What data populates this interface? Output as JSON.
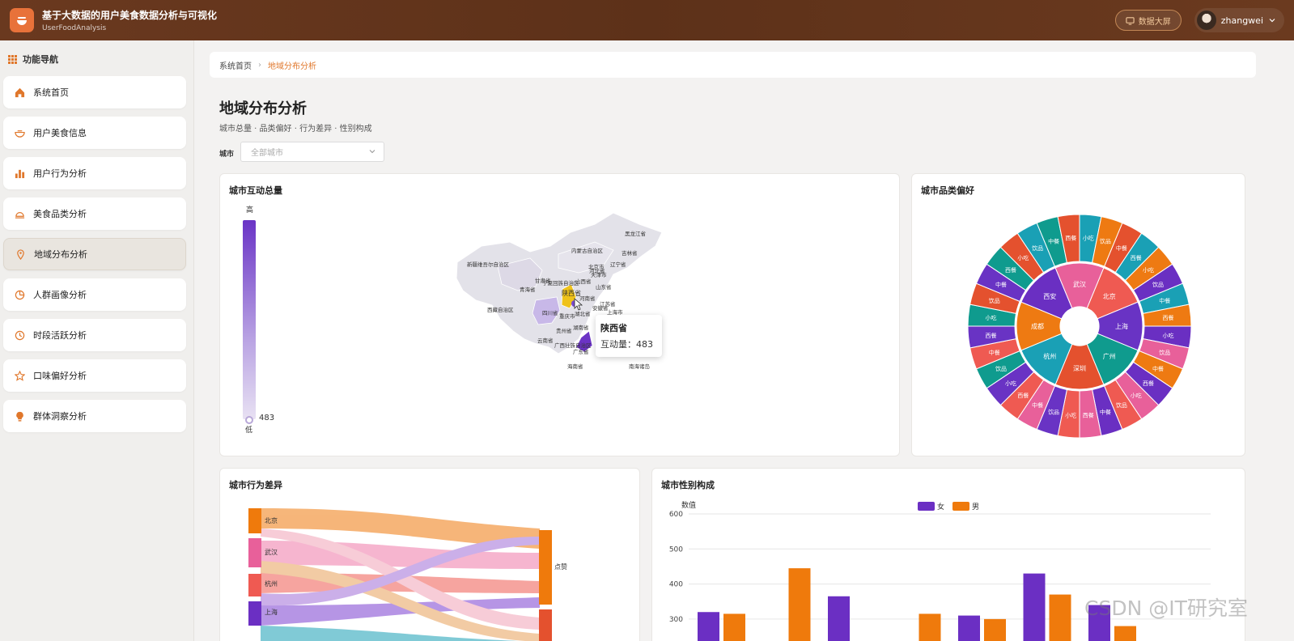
{
  "header": {
    "title": "基于大数据的用户美食数据分析与可视化",
    "subtitle": "UserFoodAnalysis",
    "screen_button": "数据大屏",
    "username": "zhangwei"
  },
  "sidebar": {
    "title": "功能导航",
    "items": [
      {
        "label": "系统首页",
        "icon": "home-icon"
      },
      {
        "label": "用户美食信息",
        "icon": "bowl-icon"
      },
      {
        "label": "用户行为分析",
        "icon": "bar-chart-icon"
      },
      {
        "label": "美食品类分析",
        "icon": "dish-icon"
      },
      {
        "label": "地域分布分析",
        "icon": "location-pin-icon",
        "active": true
      },
      {
        "label": "人群画像分析",
        "icon": "pie-icon"
      },
      {
        "label": "时段活跃分析",
        "icon": "clock-icon"
      },
      {
        "label": "口味偏好分析",
        "icon": "star-icon"
      },
      {
        "label": "群体洞察分析",
        "icon": "bulb-icon"
      }
    ]
  },
  "breadcrumb": {
    "home": "系统首页",
    "current": "地域分布分析"
  },
  "page": {
    "title": "地域分布分析",
    "subtitle": "城市总量 · 品类偏好 · 行为差异 · 性别构成",
    "filter_label": "城市",
    "filter_placeholder": "全部城市"
  },
  "map_card": {
    "title": "城市互动总量",
    "legend_high": "高",
    "legend_low": "低",
    "legend_value": "483",
    "tooltip_name": "陕西省",
    "tooltip_label": "互动量",
    "tooltip_value": "483",
    "province_labels": [
      "黑龙江省",
      "吉林省",
      "辽宁省",
      "内蒙古自治区",
      "新疆维吾尔自治区",
      "甘肃省",
      "青海省",
      "宁夏回族自治区",
      "陕西省",
      "山西省",
      "河北省",
      "北京市",
      "天津市",
      "山东省",
      "河南省",
      "江苏省",
      "安徽省",
      "上海市",
      "西藏自治区",
      "四川省",
      "重庆市",
      "湖北省",
      "湖南省",
      "贵州省",
      "云南省",
      "广西壮族自治区",
      "广东省",
      "海南省",
      "南海诸岛"
    ]
  },
  "sunburst_card": {
    "title": "城市品类偏好",
    "inner": [
      "北京",
      "上海",
      "广州",
      "深圳",
      "杭州",
      "成都",
      "西安",
      "武汉"
    ],
    "outer_categories": [
      "中餐",
      "西餐",
      "小吃",
      "饮品"
    ],
    "colors": [
      "#ef5a52",
      "#6933c4",
      "#0f9b8e",
      "#e4512e",
      "#1aa0b5",
      "#ee7a12",
      "#6a2fc2",
      "#e8609a"
    ]
  },
  "sankey_card": {
    "title": "城市行为差异",
    "sources": [
      "北京",
      "武汉",
      "杭州",
      "上海"
    ],
    "target": "点赞"
  },
  "bar_card": {
    "title": "城市性别构成",
    "y_label": "数值",
    "legend": [
      "女",
      "男"
    ],
    "colors": [
      "#6b2fc3",
      "#ef7a0c"
    ]
  },
  "chart_data": [
    {
      "type": "bar",
      "title": "城市性别构成",
      "ylabel": "数值",
      "ylim": [
        0,
        600
      ],
      "yticks": [
        300,
        400,
        500,
        600
      ],
      "series": [
        {
          "name": "女",
          "values": [
            320,
            null,
            365,
            null,
            310,
            430,
            340
          ]
        },
        {
          "name": "男",
          "values": [
            315,
            445,
            null,
            315,
            300,
            370,
            280
          ]
        }
      ]
    }
  ],
  "watermark": "CSDN @IT研究室"
}
